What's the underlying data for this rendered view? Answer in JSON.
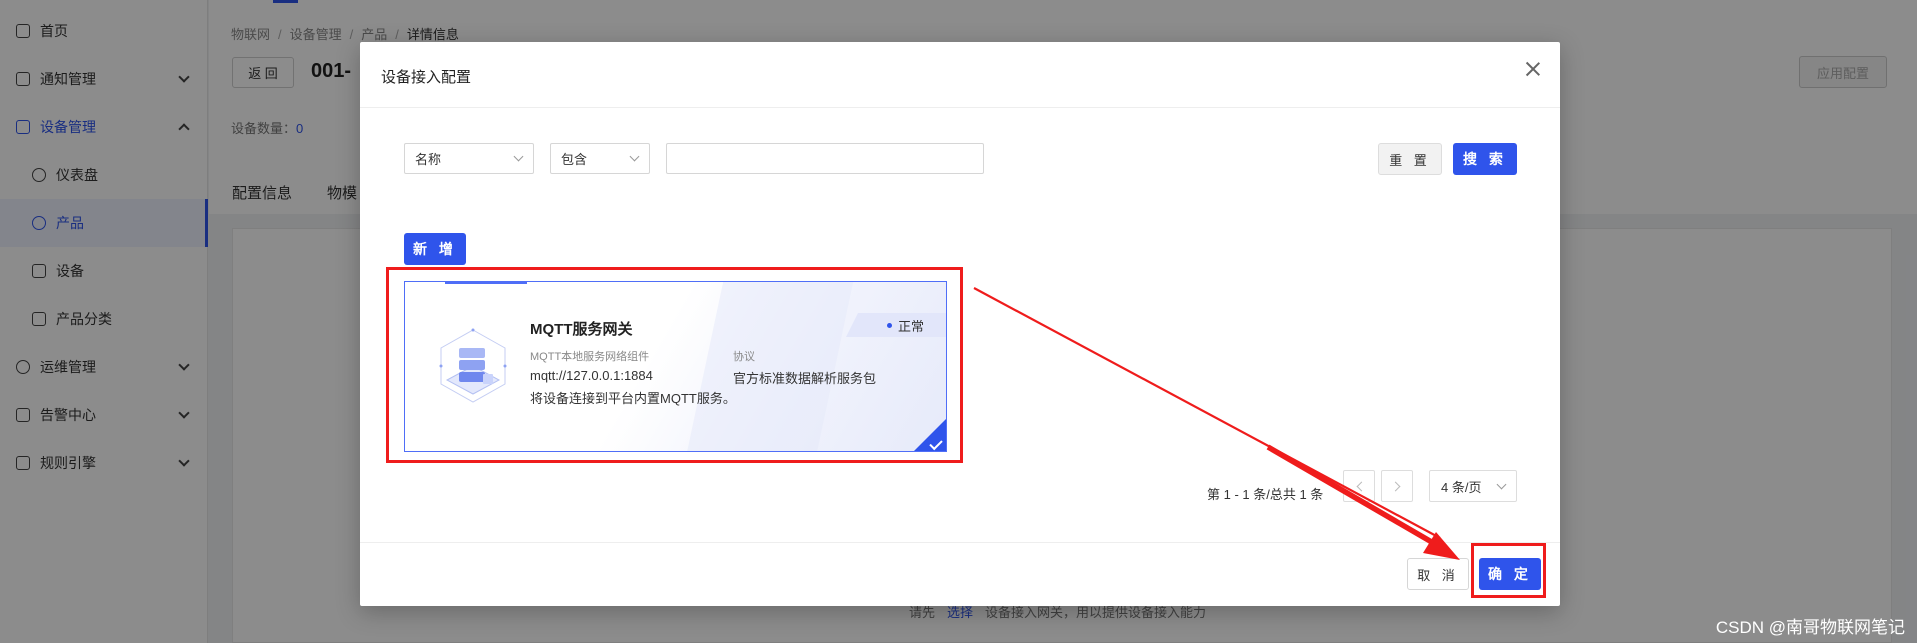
{
  "sidebar": {
    "items": [
      {
        "label": "首页",
        "icon": "home-icon"
      },
      {
        "label": "通知管理",
        "icon": "notification-icon"
      },
      {
        "label": "设备管理",
        "icon": "device-management-icon"
      },
      {
        "label": "仪表盘",
        "icon": "dashboard-icon"
      },
      {
        "label": "产品",
        "icon": "product-icon"
      },
      {
        "label": "设备",
        "icon": "device-icon"
      },
      {
        "label": "产品分类",
        "icon": "category-icon"
      },
      {
        "label": "运维管理",
        "icon": "operations-icon"
      },
      {
        "label": "告警中心",
        "icon": "alarm-icon"
      },
      {
        "label": "规则引擎",
        "icon": "rule-engine-icon"
      }
    ]
  },
  "breadcrumb": [
    "物联网",
    "设备管理",
    "产品",
    "详情信息"
  ],
  "page": {
    "back_label": "返 回",
    "title": "001-",
    "apply_label": "应用配置",
    "device_count_label": "设备数量：",
    "device_count": "0",
    "tabs": [
      "配置信息",
      "物模"
    ],
    "bottom_hint_prefix": "请先",
    "bottom_hint_link": "选择",
    "bottom_hint_suffix": "设备接入网关，用以提供设备接入能力"
  },
  "modal": {
    "title": "设备接入配置",
    "filter": {
      "field_value": "名称",
      "operator_value": "包含",
      "keyword_value": "",
      "reset_label": "重 置",
      "search_label": "搜 索"
    },
    "add_label": "新 增",
    "card": {
      "name": "MQTT服务网关",
      "status": "正常",
      "component_label": "MQTT本地服务网络组件",
      "address": "mqtt://127.0.0.1:1884",
      "protocol_label": "协议",
      "protocol": "官方标准数据解析服务包",
      "description": "将设备连接到平台内置MQTT服务。",
      "selected": true
    },
    "pagination": {
      "info": "第 1 - 1 条/总共 1 条",
      "page_size": "4 条/页"
    },
    "cancel_label": "取 消",
    "confirm_label": "确 定"
  },
  "watermark": "CSDN @南哥物联网笔记",
  "colors": {
    "primary": "#2f54eb",
    "annotation_red": "#ef1c1c"
  }
}
